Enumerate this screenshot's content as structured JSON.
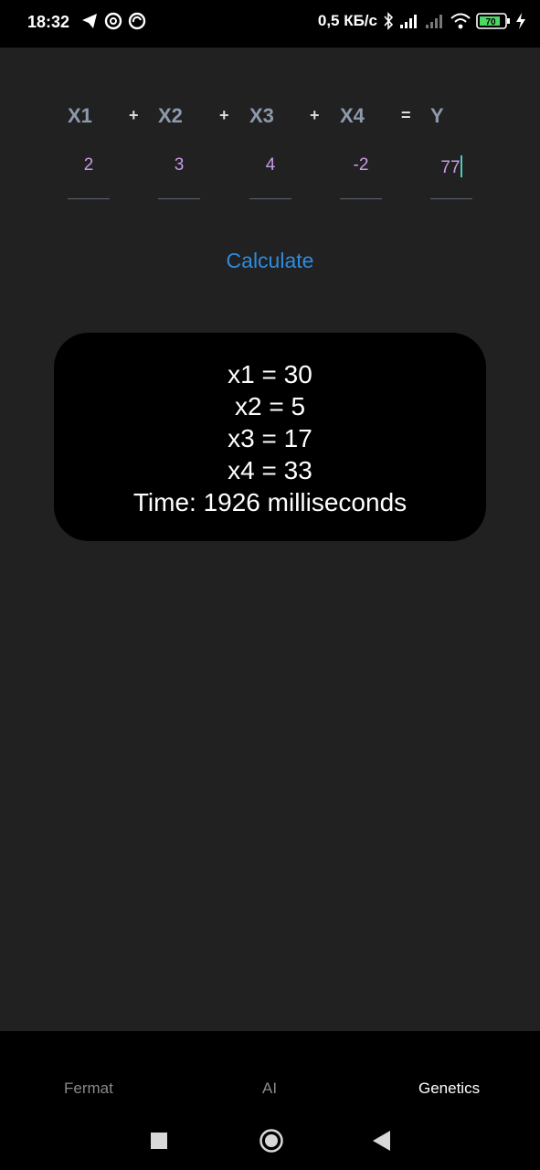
{
  "status_bar": {
    "time": "18:32",
    "speed": "0,5 КБ/с",
    "battery": "70"
  },
  "equation": {
    "labels": [
      "X1",
      "X2",
      "X3",
      "X4",
      "Y"
    ],
    "operators": [
      "+",
      "+",
      "+",
      "="
    ],
    "inputs": [
      "2",
      "3",
      "4",
      "-2",
      "77"
    ]
  },
  "calculate_label": "Calculate",
  "result": {
    "lines": [
      "x1 = 30",
      "x2 = 5",
      "x3 = 17",
      "x4 = 33",
      "Time: 1926 milliseconds"
    ]
  },
  "bottom_nav": {
    "items": [
      "Fermat",
      "AI",
      "Genetics"
    ],
    "active": "Genetics"
  },
  "colors": {
    "background": "#212121",
    "label": "#8c9aab",
    "input_text": "#c89ce8",
    "accent": "#2f8bdb",
    "cursor": "#4fc9c0"
  }
}
